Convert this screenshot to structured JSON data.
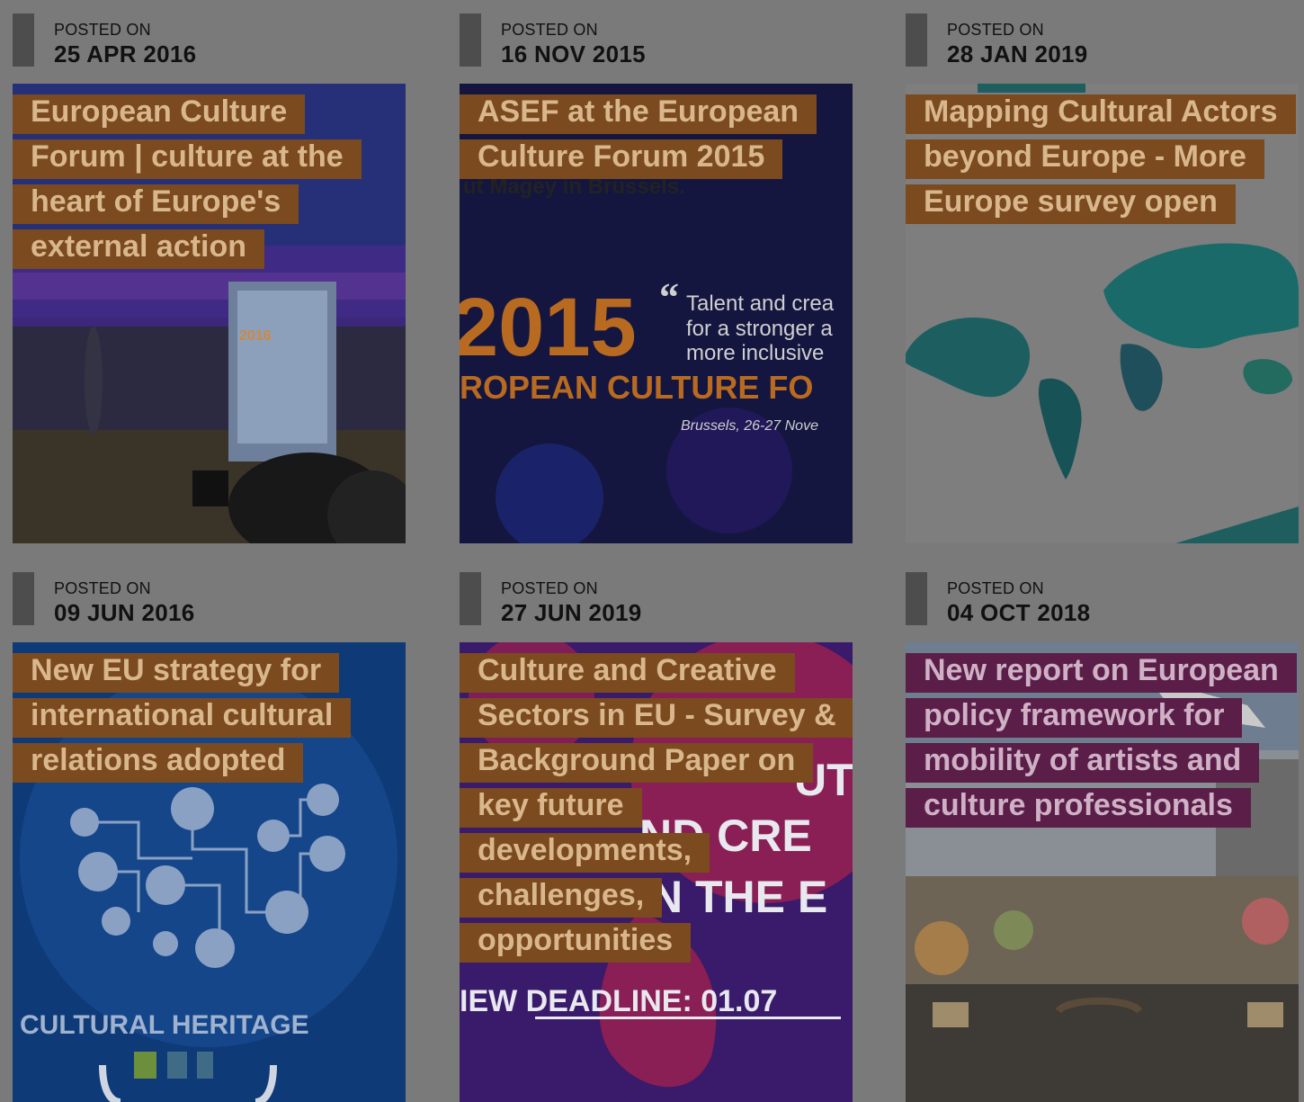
{
  "posts": [
    {
      "label": "POSTED ON",
      "date": "25 APR 2016",
      "title": "European Culture Forum | culture at the heart of Europe's external action",
      "image_text": [
        "2016"
      ]
    },
    {
      "label": "POSTED ON",
      "date": "16 NOV 2015",
      "title": "ASEF at the European Culture Forum 2015",
      "image_text": [
        "2015",
        "“",
        "Talent and crea",
        "for a stronger a",
        "more inclusive",
        "ROPEAN CULTURE FO",
        "Brussels, 26-27 Nove",
        "ut Magey in Brussels."
      ]
    },
    {
      "label": "POSTED ON",
      "date": "28 JAN 2019",
      "title": "Mapping Cultural Actors beyond Europe - More Europe survey open",
      "image_text": []
    },
    {
      "label": "POSTED ON",
      "date": "09 JUN 2016",
      "title": "New EU strategy for international cultural relations adopted",
      "image_text": [
        "CULTURAL HERITAGE"
      ]
    },
    {
      "label": "POSTED ON",
      "date": "27 JUN 2019",
      "title": "Culture and Creative Sectors in EU - Survey & Background Paper on key future developments, challenges, opportunities",
      "image_text": [
        "UT",
        "ND CRE",
        "N THE E",
        "IEW DEADLINE: 01.07"
      ]
    },
    {
      "label": "POSTED ON",
      "date": "04 OCT 2018",
      "title": "New report on European policy framework for mobility of artists and culture professionals",
      "image_text": []
    }
  ],
  "colors": {
    "overlay": "#7a7a7a",
    "title_bg": "#7b4a1e",
    "title_bg_alt": "#5a1e48"
  }
}
